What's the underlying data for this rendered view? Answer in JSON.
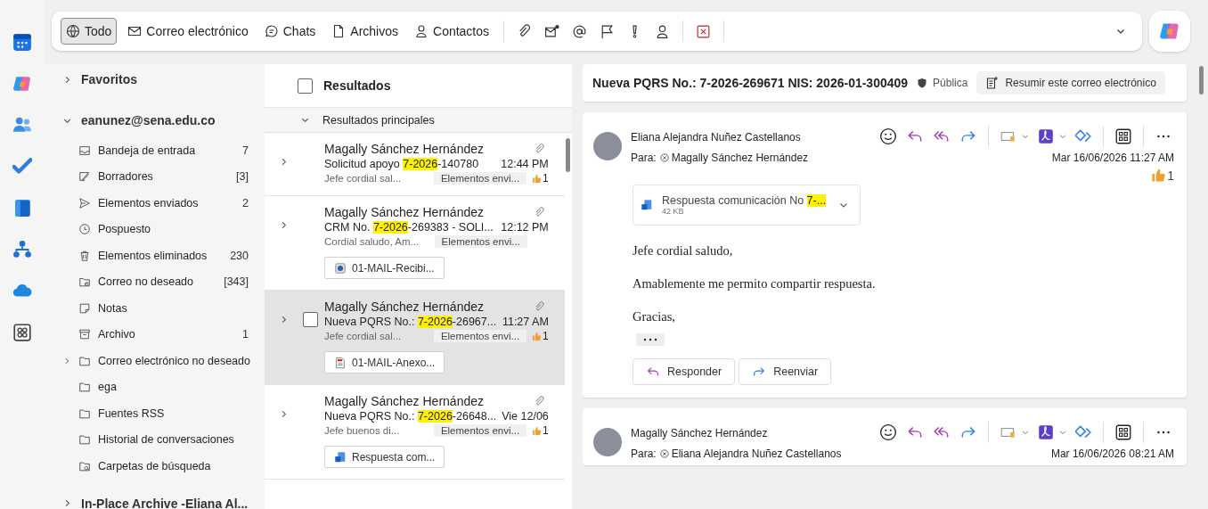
{
  "toolbar": {
    "filters": [
      {
        "label": "Todo",
        "selected": true,
        "kind": "all"
      },
      {
        "label": "Correo electrónico",
        "selected": false,
        "kind": "mail"
      },
      {
        "label": "Chats",
        "selected": false,
        "kind": "chat"
      },
      {
        "label": "Archivos",
        "selected": false,
        "kind": "file"
      },
      {
        "label": "Contactos",
        "selected": false,
        "kind": "person"
      }
    ]
  },
  "folders": {
    "favorites": {
      "label": "Favoritos",
      "expanded": false
    },
    "account": {
      "label": "eanunez@sena.edu.co",
      "expanded": true
    },
    "items": [
      {
        "label": "Bandeja de entrada",
        "count": "7",
        "kind": "inbox",
        "expandable": false
      },
      {
        "label": "Borradores",
        "count": "[3]",
        "kind": "drafts",
        "expandable": false
      },
      {
        "label": "Elementos enviados",
        "count": "2",
        "kind": "sent",
        "expandable": false
      },
      {
        "label": "Pospuesto",
        "kind": "clock",
        "expandable": false
      },
      {
        "label": "Elementos eliminados",
        "count": "230",
        "kind": "trash",
        "expandable": false
      },
      {
        "label": "Correo no deseado",
        "count": "[343]",
        "kind": "junk",
        "expandable": false
      },
      {
        "label": "Notas",
        "kind": "note",
        "expandable": false
      },
      {
        "label": "Archivo",
        "count": "1",
        "kind": "archive",
        "expandable": false
      },
      {
        "label": "Correo electrónico no deseado",
        "kind": "folder",
        "expandable": true
      },
      {
        "label": "ega",
        "kind": "folder",
        "expandable": false
      },
      {
        "label": "Fuentes RSS",
        "kind": "folder",
        "expandable": false
      },
      {
        "label": "Historial de conversaciones",
        "kind": "folder",
        "expandable": false
      },
      {
        "label": "Carpetas de búsqueda",
        "kind": "search",
        "expandable": false
      }
    ],
    "archive": {
      "label": "In-Place Archive -Eliana Al...",
      "expanded": false
    }
  },
  "list": {
    "title": "Resultados",
    "checked": false,
    "group": {
      "label": "Resultados principales",
      "expanded": true
    },
    "items": [
      {
        "sender": "Magally Sánchez Hernández",
        "subject": {
          "before": "Solicitud apoyo ",
          "match": "7-2026",
          "after": "-140780"
        },
        "time": "12:44 PM",
        "preview": "Jefe cordial sal...",
        "folder": "Elementos envi...",
        "reactions": "1",
        "selected": false
      },
      {
        "sender": "Magally Sánchez Hernández",
        "subject": {
          "before": "CRM No. ",
          "match": "7-2026",
          "after": "-269383 - SOLI..."
        },
        "time": "12:12 PM",
        "preview": "Cordial saludo, Am...",
        "folder": "Elementos envi...",
        "attachment": {
          "name": "01-MAIL-Recibi...",
          "kind": "web"
        },
        "selected": false
      },
      {
        "sender": "Magally Sánchez Hernández",
        "subject": {
          "before": "Nueva PQRS No.: ",
          "match": "7-2026",
          "after": "-26967..."
        },
        "time": "11:27 AM",
        "preview": "Jefe cordial sal...",
        "folder": "Elementos envi...",
        "reactions": "1",
        "attachment": {
          "name": "01-MAIL-Anexo...",
          "kind": "pdf"
        },
        "selected": true
      },
      {
        "sender": "Magally Sánchez Hernández",
        "subject": {
          "before": "Nueva PQRS No.: ",
          "match": "7-2026",
          "after": "-26648..."
        },
        "time": "Vie 12/06",
        "preview": "Jefe buenos di...",
        "folder": "Elementos envi...",
        "reactions": "1",
        "attachment": {
          "name": "Respuesta com...",
          "kind": "word"
        },
        "selected": false
      }
    ]
  },
  "reading": {
    "subject": "Nueva PQRS No.: 7-2026-269671 NIS: 2026-01-300409",
    "label": "Pública",
    "summarize": "Resumir este correo electrónico",
    "messages": [
      {
        "sender": "Eliana Alejandra Nuñez Castellanos",
        "to_label": "Para:",
        "to": "Magally Sánchez Hernández",
        "date": "Mar 16/06/2026 11:27 AM",
        "reactions": "1",
        "attachment": {
          "name": "Respuesta comunicación No ",
          "match": "7-...",
          "size": "42 KB"
        },
        "body": [
          "Jefe cordial saludo,",
          "Amablemente me permito compartir  respuesta.",
          "Gracias,"
        ],
        "actions": [
          "Responder",
          "Reenviar"
        ]
      },
      {
        "sender": "Magally Sánchez Hernández",
        "to_label": "Para:",
        "to": "Eliana Alejandra Nuñez Castellanos",
        "date": "Mar 16/06/2026 08:21 AM"
      }
    ]
  }
}
